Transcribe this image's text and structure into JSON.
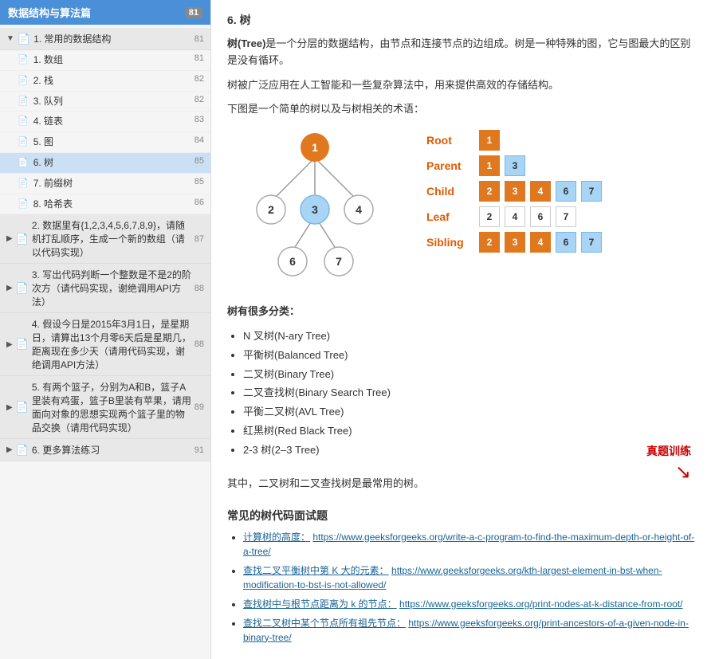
{
  "sidebar": {
    "header": "数据结构与算法篇",
    "header_count": "81",
    "groups": [
      {
        "id": "group1",
        "label": "1. 常用的数据结构",
        "page": "81",
        "expanded": true,
        "items": [
          {
            "id": "item1",
            "label": "1. 数组",
            "page": "81"
          },
          {
            "id": "item2",
            "label": "2. 栈",
            "page": "82"
          },
          {
            "id": "item3",
            "label": "3. 队列",
            "page": "82"
          },
          {
            "id": "item4",
            "label": "4. 链表",
            "page": "83"
          },
          {
            "id": "item5",
            "label": "5. 图",
            "page": "84"
          },
          {
            "id": "item6",
            "label": "6. 树",
            "page": "85",
            "active": true
          },
          {
            "id": "item7",
            "label": "7. 前缀树",
            "page": "85"
          },
          {
            "id": "item8",
            "label": "8. 哈希表",
            "page": "86"
          }
        ]
      },
      {
        "id": "group2",
        "label": "2. 数据里有{1,2,3,4,5,6,7,8,9}，请随机打乱顺序，生成一个新的数组（请以代码实现）",
        "page": "87",
        "expanded": false,
        "items": []
      },
      {
        "id": "group3",
        "label": "3. 写出代码判断一个整数是不是2的阶次方（请代码实现，谢绝调用API方法）",
        "page": "88",
        "expanded": false,
        "items": []
      },
      {
        "id": "group4",
        "label": "4. 假设今日是2015年3月1日，是星期日，请算出13个月零6天后是星期几，距离现在多少天（请用代码实现，谢绝调用API方法）",
        "page": "88",
        "expanded": false,
        "items": []
      },
      {
        "id": "group5",
        "label": "5. 有两个篮子，分别为A和B，篮子A里装有鸡蛋，篮子B里装有苹果，请用面向对象的思想实现两个篮子里的物品交换（请用代码实现）",
        "page": "89",
        "expanded": false,
        "items": []
      },
      {
        "id": "group6",
        "label": "6. 更多算法练习",
        "page": "91",
        "expanded": false,
        "items": []
      }
    ]
  },
  "main": {
    "section_number": "6. 树",
    "intro_p1_before_bold": "",
    "intro_bold": "树(Tree)",
    "intro_p1_after": "是一个分层的数据结构，由节点和连接节点的边组成。树是一种特殊的图，它与图最大的区别是没有循环。",
    "intro_p2": "树被广泛应用在人工智能和一些复杂算法中，用来提供高效的存储结构。",
    "intro_p3": "下图是一个简单的树以及与树相关的术语：",
    "tree_nodes": {
      "root": "1",
      "children_of_root": [
        "2",
        "3",
        "4"
      ],
      "children_of_3": [
        "6",
        "7"
      ]
    },
    "legend": [
      {
        "label": "Root",
        "nodes": [
          {
            "val": "1",
            "type": "orange"
          }
        ]
      },
      {
        "label": "Parent",
        "nodes": [
          {
            "val": "1",
            "type": "orange"
          },
          {
            "val": "3",
            "type": "blue"
          }
        ]
      },
      {
        "label": "Child",
        "nodes": [
          {
            "val": "2",
            "type": "orange"
          },
          {
            "val": "3",
            "type": "orange"
          },
          {
            "val": "4",
            "type": "orange"
          },
          {
            "val": "6",
            "type": "blue"
          },
          {
            "val": "7",
            "type": "blue"
          }
        ]
      },
      {
        "label": "Leaf",
        "nodes": [
          {
            "val": "2",
            "type": "white"
          },
          {
            "val": "4",
            "type": "white"
          },
          {
            "val": "6",
            "type": "white"
          },
          {
            "val": "7",
            "type": "white"
          }
        ]
      },
      {
        "label": "Sibling",
        "nodes": [
          {
            "val": "2",
            "type": "orange"
          },
          {
            "val": "3",
            "type": "orange"
          },
          {
            "val": "4",
            "type": "orange"
          },
          {
            "val": "6",
            "type": "blue"
          },
          {
            "val": "7",
            "type": "blue"
          }
        ]
      }
    ],
    "categories_header": "树有很多分类：",
    "categories": [
      "N 叉树(N-ary Tree)",
      "平衡树(Balanced Tree)",
      "二叉树(Binary Tree)",
      "二叉查找树(Binary Search Tree)",
      "平衡二叉树(AVL Tree)",
      "红黑树(Red Black Tree)",
      "2-3 树(2–3 Tree)"
    ],
    "summary": "其中，二叉树和二叉查找树是最常用的树。",
    "annotation_text": "真题训练",
    "problems_header": "常见的树代码面试题",
    "problems": [
      {
        "link_text": "计算树的高度：",
        "url_text": "https://www.geeksforgeeks.org/write-a-c-program-to-find-the-maximum-depth-or-height-of-a-tree/"
      },
      {
        "link_text": "查找二叉平衡树中第 K 大的元素：",
        "url_text": "https://www.geeksforgeeks.org/kth-largest-element-in-bst-when-modification-to-bst-is-not-allowed/"
      },
      {
        "link_text": "查找树中与根节点距离为 k 的节点：",
        "url_text": "https://www.geeksforgeeks.org/print-nodes-at-k-distance-from-root/"
      },
      {
        "link_text": "查找二叉树中某个节点所有祖先节点：",
        "url_text": "https://www.geeksforgeeks.org/print-ancestors-of-a-given-node-in-binary-tree/"
      }
    ]
  },
  "colors": {
    "accent_blue": "#4a90d9",
    "orange": "#e07820",
    "light_blue": "#a8d4f5",
    "red": "#cc0000"
  }
}
